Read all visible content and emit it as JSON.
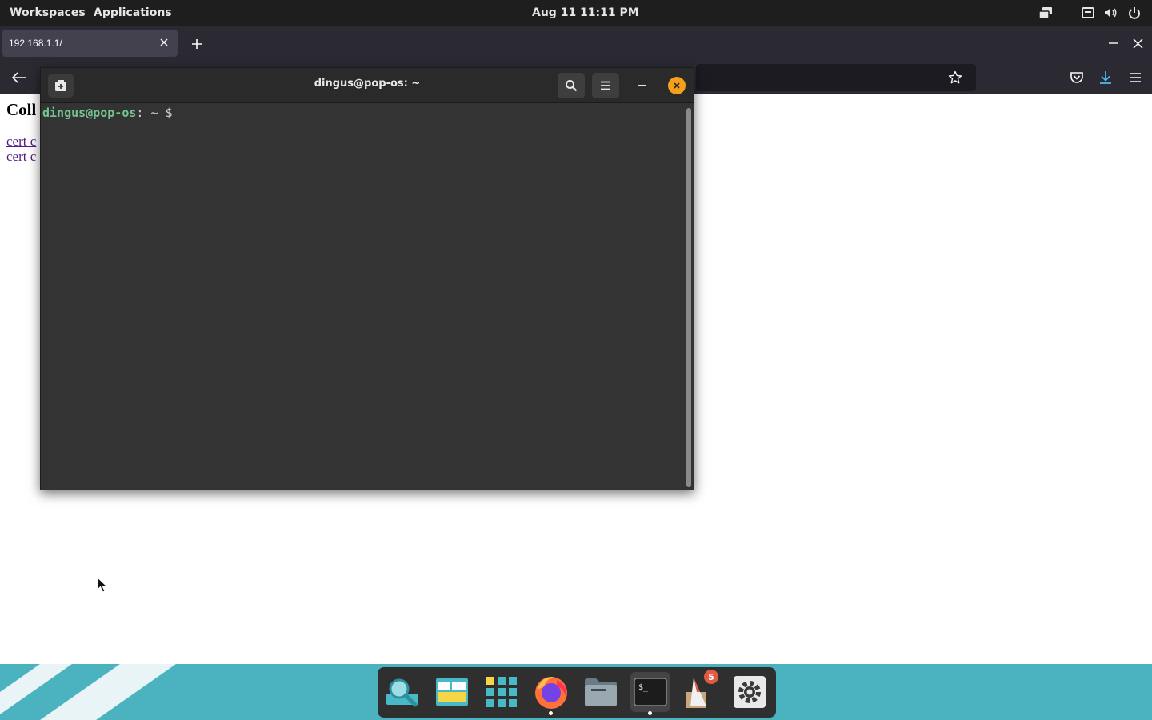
{
  "topbar": {
    "workspaces": "Workspaces",
    "applications": "Applications",
    "clock": "Aug 11  11:11 PM"
  },
  "browser": {
    "tab_title": "192.168.1.1/",
    "icons": [
      "back-arrow-icon",
      "star-icon",
      "pocket-icon",
      "download-icon",
      "menu-icon",
      "new-tab-icon",
      "close-icon",
      "minimize-icon"
    ]
  },
  "page": {
    "heading": "Coll",
    "links": [
      "cert c",
      "cert c"
    ]
  },
  "terminal": {
    "title": "dingus@pop-os: ~",
    "prompt_user": "dingus@pop-os",
    "prompt_sep": ":",
    "prompt_path": " ~",
    "prompt_symbol": " $"
  },
  "dock": {
    "items": [
      "search",
      "workspaces",
      "app-grid",
      "firefox",
      "files",
      "terminal",
      "pop-shop",
      "settings"
    ],
    "shop_badge": "5"
  },
  "colors": {
    "topbar": "#1e1e1e",
    "browser_chrome": "#2b2a33",
    "terminal_bg": "#333333",
    "prompt_green": "#73c48f",
    "close_orange": "#f6a01a",
    "wallpaper": "#4ab3bf",
    "download_blue": "#4fb3e8"
  }
}
